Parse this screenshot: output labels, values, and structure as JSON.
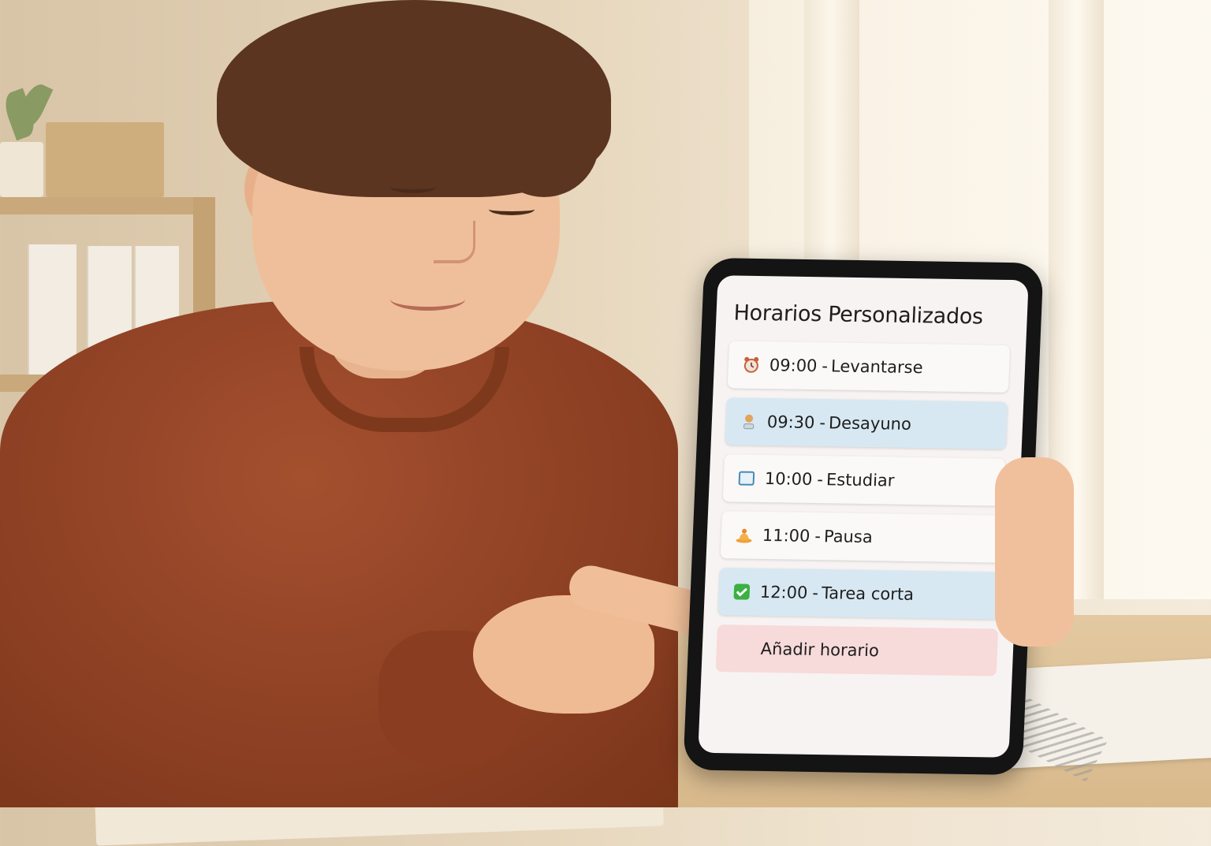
{
  "app": {
    "title": "Horarios Personalizados"
  },
  "schedule": {
    "items": [
      {
        "time": "09:00",
        "sep": "-",
        "label": "Levantarse",
        "icon": "alarm-clock-icon",
        "style": "white"
      },
      {
        "time": "09:30",
        "sep": "-",
        "label": "Desayuno",
        "icon": "breakfast-icon",
        "style": "blue"
      },
      {
        "time": "10:00",
        "sep": "-",
        "label": "Estudiar",
        "icon": "book-icon",
        "style": "white"
      },
      {
        "time": "11:00",
        "sep": "-",
        "label": "Pausa",
        "icon": "pause-icon",
        "style": "white"
      },
      {
        "time": "12:00",
        "sep": "-",
        "label": "Tarea corta",
        "icon": "checkmark-icon",
        "style": "blue"
      }
    ],
    "add_label": "Añadir horario"
  },
  "colors": {
    "row_blue": "#d7e8f2",
    "row_white": "#fbf9f8",
    "add_button": "#f7dada",
    "check_green": "#3cb043"
  }
}
